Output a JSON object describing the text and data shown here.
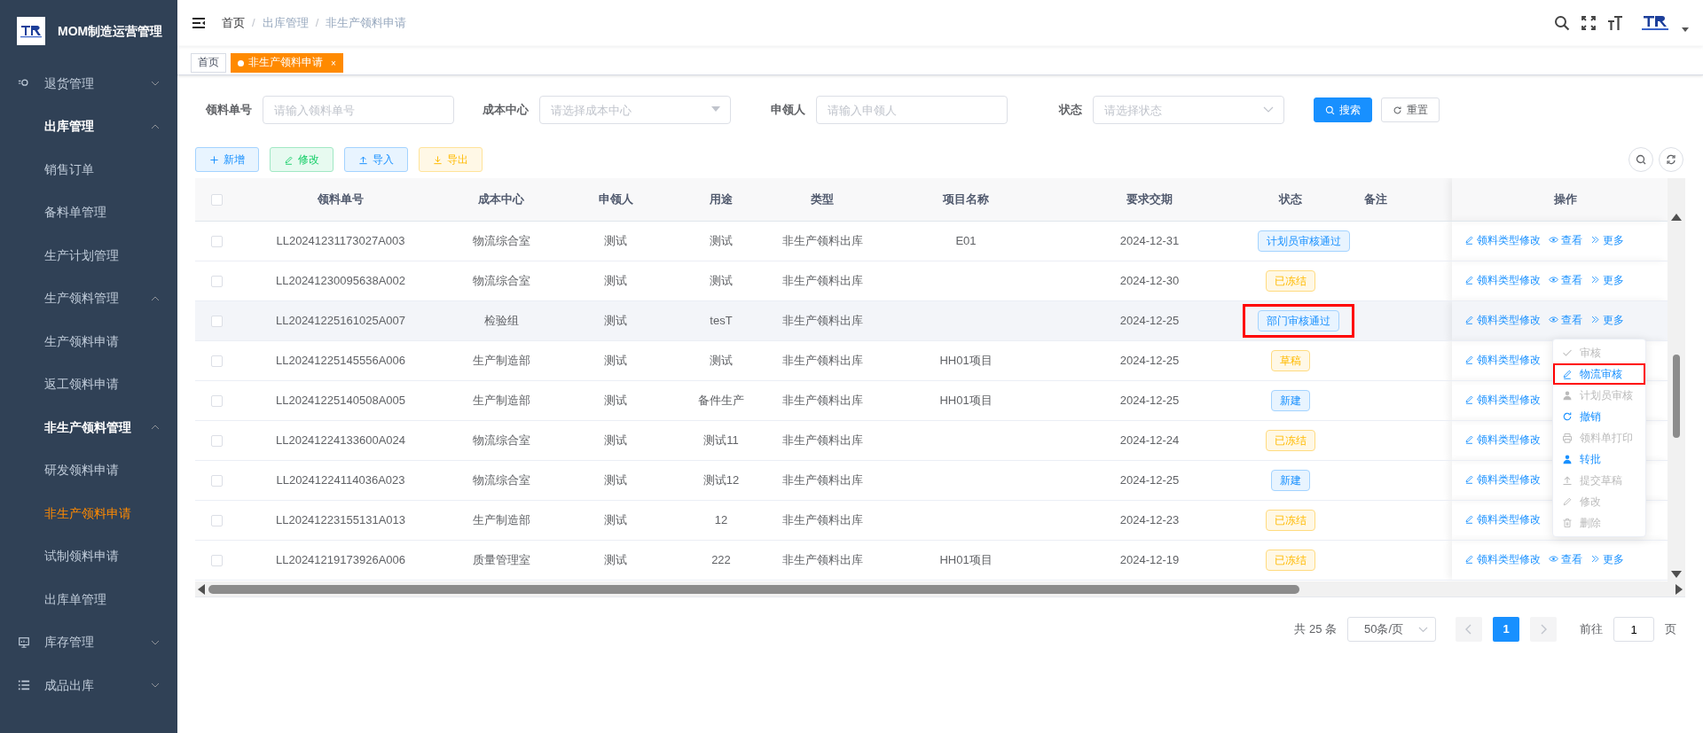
{
  "sidebar": {
    "title": "MOM制造运营管理",
    "items": [
      {
        "label": "退货管理",
        "expanded": false
      },
      {
        "label": "出库管理",
        "expanded": true,
        "children": [
          {
            "label": "销售订单",
            "selected": false
          },
          {
            "label": "备料单管理",
            "selected": false
          },
          {
            "label": "生产计划管理",
            "selected": false
          },
          {
            "label": "生产领料管理",
            "expanded": true,
            "children": [
              {
                "label": "生产领料申请",
                "selected": false
              },
              {
                "label": "返工领料申请",
                "selected": false
              }
            ]
          },
          {
            "label": "非生产领料管理",
            "expanded": true,
            "children": [
              {
                "label": "研发领料申请",
                "selected": false
              },
              {
                "label": "非生产领料申请",
                "selected": true
              },
              {
                "label": "试制领料申请",
                "selected": false
              }
            ]
          },
          {
            "label": "出库单管理",
            "selected": false
          }
        ]
      },
      {
        "label": "库存管理",
        "expanded": false
      },
      {
        "label": "成品出库",
        "expanded": false
      }
    ]
  },
  "breadcrumb": [
    {
      "label": "首页"
    },
    {
      "separator": "/",
      "label": "出库管理"
    },
    {
      "separator": "/",
      "label": "非生产领料申请"
    }
  ],
  "tabs": [
    {
      "label": "首页",
      "selected": false
    },
    {
      "label": "非生产领料申请",
      "selected": true,
      "close": "×"
    }
  ],
  "filters": [
    {
      "label": "领料单号",
      "kind": "input",
      "placeholder": "请输入领料单号"
    },
    {
      "label": "成本中心",
      "kind": "select",
      "placeholder": "请选择成本中心"
    },
    {
      "label": "申领人",
      "kind": "input",
      "placeholder": "请输入申领人"
    },
    {
      "label": "状态",
      "kind": "select",
      "placeholder": "请选择状态"
    }
  ],
  "filter_buttons": [
    {
      "label": "搜索",
      "kind": "primary"
    },
    {
      "label": "重置",
      "kind": "default"
    }
  ],
  "toolbar": [
    {
      "label": "新增",
      "kind": "primary"
    },
    {
      "label": "修改",
      "kind": "success"
    },
    {
      "label": "导入",
      "kind": "info"
    },
    {
      "label": "导出",
      "kind": "warning"
    }
  ],
  "table": {
    "all_checked": false,
    "columns": [
      "领料单号",
      "成本中心",
      "申领人",
      "用途",
      "类型",
      "项目名称",
      "要求交期",
      "状态",
      "备注",
      "操作"
    ],
    "rows": [
      {
        "checked": false,
        "cells": [
          "LL20241231173027A003",
          "物流综合室",
          "测试",
          "测试",
          "非生产领料出库",
          "E01",
          "2024-12-31"
        ],
        "status": {
          "label": "计划员审核通过",
          "kind": "primary"
        },
        "highlighted": false,
        "hovered": false,
        "actions": [
          "领料类型修改",
          "查看",
          "更多"
        ]
      },
      {
        "checked": false,
        "cells": [
          "LL20241230095638A002",
          "物流综合室",
          "测试",
          "测试",
          "非生产领料出库",
          "",
          "2024-12-30"
        ],
        "status": {
          "label": "已冻结",
          "kind": "warning"
        },
        "highlighted": false,
        "hovered": false,
        "actions": [
          "领料类型修改",
          "查看",
          "更多"
        ]
      },
      {
        "checked": false,
        "cells": [
          "LL20241225161025A007",
          "检验组",
          "测试",
          "tesT",
          "非生产领料出库",
          "",
          "2024-12-25"
        ],
        "status": {
          "label": "部门审核通过",
          "kind": "primary"
        },
        "highlighted": true,
        "hovered": true,
        "actions": [
          "领料类型修改",
          "查看",
          "更多"
        ]
      },
      {
        "checked": false,
        "cells": [
          "LL20241225145556A006",
          "生产制造部",
          "测试",
          "测试",
          "非生产领料出库",
          "HH01项目",
          "2024-12-25"
        ],
        "status": {
          "label": "草稿",
          "kind": "warning"
        },
        "highlighted": false,
        "hovered": false,
        "actions": [
          "领料类型修改"
        ]
      },
      {
        "checked": false,
        "cells": [
          "LL20241225140508A005",
          "生产制造部",
          "测试",
          "备件生产",
          "非生产领料出库",
          "HH01项目",
          "2024-12-25"
        ],
        "status": {
          "label": "新建",
          "kind": "primary"
        },
        "highlighted": false,
        "hovered": false,
        "actions": [
          "领料类型修改"
        ]
      },
      {
        "checked": false,
        "cells": [
          "LL20241224133600A024",
          "物流综合室",
          "测试",
          "测试11",
          "非生产领料出库",
          "",
          "2024-12-24"
        ],
        "status": {
          "label": "已冻结",
          "kind": "warning"
        },
        "highlighted": false,
        "hovered": false,
        "actions": [
          "领料类型修改"
        ]
      },
      {
        "checked": false,
        "cells": [
          "LL20241224114036A023",
          "物流综合室",
          "测试",
          "测试12",
          "非生产领料出库",
          "",
          "2024-12-25"
        ],
        "status": {
          "label": "新建",
          "kind": "primary"
        },
        "highlighted": false,
        "hovered": false,
        "actions": [
          "领料类型修改"
        ]
      },
      {
        "checked": false,
        "cells": [
          "LL20241223155131A013",
          "生产制造部",
          "测试",
          "12",
          "非生产领料出库",
          "",
          "2024-12-23"
        ],
        "status": {
          "label": "已冻结",
          "kind": "warning"
        },
        "highlighted": false,
        "hovered": false,
        "actions": [
          "领料类型修改"
        ]
      },
      {
        "checked": false,
        "cells": [
          "LL20241219173926A006",
          "质量管理室",
          "测试",
          "222",
          "非生产领料出库",
          "HH01项目",
          "2024-12-19"
        ],
        "status": {
          "label": "已冻结",
          "kind": "warning"
        },
        "highlighted": false,
        "hovered": false,
        "actions": [
          "领料类型修改",
          "查看",
          "更多"
        ]
      }
    ]
  },
  "more_menu": [
    {
      "label": "审核",
      "disabled": true,
      "highlighted": false
    },
    {
      "label": "物流审核",
      "disabled": false,
      "highlighted": true
    },
    {
      "label": "计划员审核",
      "disabled": true,
      "highlighted": false
    },
    {
      "label": "撤销",
      "disabled": false,
      "highlighted": false
    },
    {
      "label": "领料单打印",
      "disabled": true,
      "highlighted": false
    },
    {
      "label": "转批",
      "disabled": false,
      "highlighted": false
    },
    {
      "label": "提交草稿",
      "disabled": true,
      "highlighted": false
    },
    {
      "label": "修改",
      "disabled": true,
      "highlighted": false
    },
    {
      "label": "删除",
      "disabled": true,
      "highlighted": false
    }
  ],
  "pagination": {
    "total": "共 25 条",
    "page_size": "50条/页",
    "pages": [
      {
        "label": "1",
        "selected": true
      }
    ],
    "goto_label": "前往",
    "goto_value": "1",
    "goto_suffix": "页"
  }
}
